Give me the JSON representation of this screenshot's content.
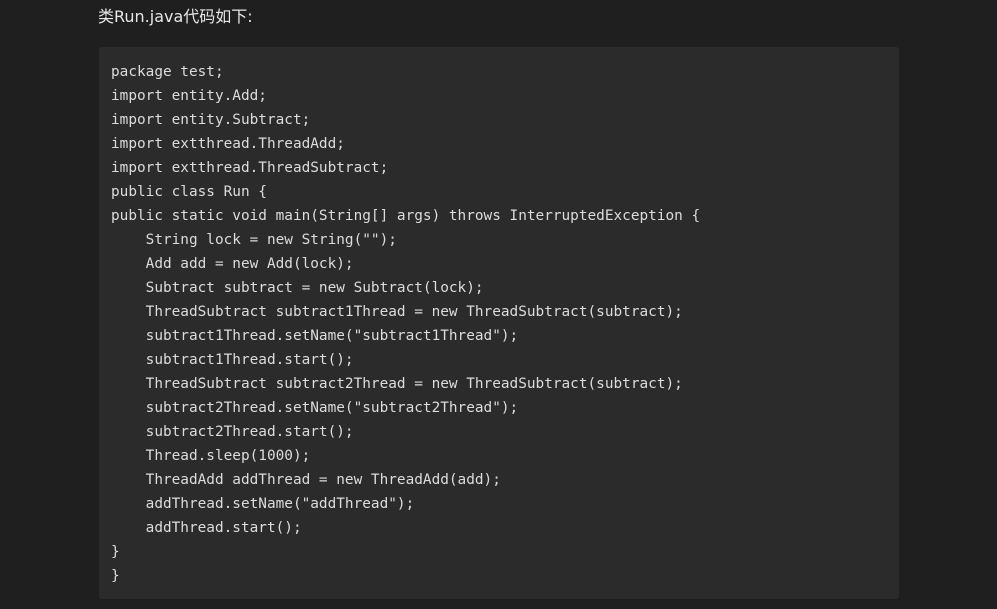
{
  "intro": {
    "text": "类Run.java代码如下:"
  },
  "code": {
    "lines": [
      "package test;",
      "import entity.Add;",
      "import entity.Subtract;",
      "import extthread.ThreadAdd;",
      "import extthread.ThreadSubtract;",
      "public class Run {",
      "public static void main(String[] args) throws InterruptedException {",
      "    String lock = new String(\"\");",
      "    Add add = new Add(lock);",
      "    Subtract subtract = new Subtract(lock);",
      "    ThreadSubtract subtract1Thread = new ThreadSubtract(subtract);",
      "    subtract1Thread.setName(\"subtract1Thread\");",
      "    subtract1Thread.start();",
      "    ThreadSubtract subtract2Thread = new ThreadSubtract(subtract);",
      "    subtract2Thread.setName(\"subtract2Thread\");",
      "    subtract2Thread.start();",
      "    Thread.sleep(1000);",
      "    ThreadAdd addThread = new ThreadAdd(add);",
      "    addThread.setName(\"addThread\");",
      "    addThread.start();",
      "}",
      "}"
    ]
  }
}
